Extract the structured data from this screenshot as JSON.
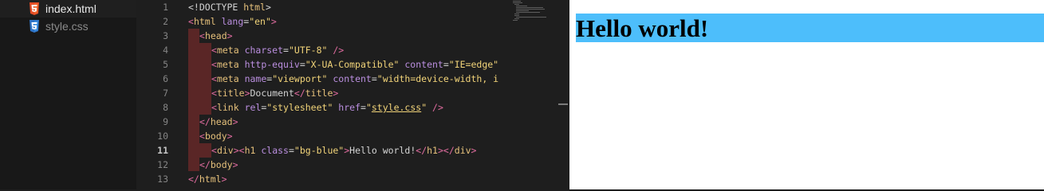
{
  "sidebar": {
    "files": [
      {
        "name": "index.html",
        "icon": "html5-file-icon",
        "icon_color": "#e44d26",
        "active": true
      },
      {
        "name": "style.css",
        "icon": "css3-file-icon",
        "icon_color": "#3d8fe0",
        "active": false
      }
    ]
  },
  "editor": {
    "current_line": "11",
    "line_numbers": [
      "1",
      "2",
      "3",
      "4",
      "5",
      "6",
      "7",
      "8",
      "9",
      "10",
      "11",
      "12",
      "13"
    ],
    "lines": {
      "l1": {
        "p1": "<!DOCTYPE ",
        "p2": "html",
        "p3": ">"
      },
      "l2": {
        "p1": "<",
        "p2": "html",
        "p3": " lang",
        "p4": "=",
        "p5": "\"en\"",
        "p6": ">"
      },
      "l3": {
        "p1": "<",
        "p2": "head",
        "p3": ">"
      },
      "l4": {
        "p1": "<",
        "p2": "meta",
        "p3": " charset",
        "p4": "=",
        "p5": "\"UTF-8\"",
        "p6": " />"
      },
      "l5": {
        "p1": "<",
        "p2": "meta",
        "p3": " http-equiv",
        "p4": "=",
        "p5": "\"X-UA-Compatible\"",
        "p6": " content",
        "p7": "=",
        "p8": "\"IE=edge\""
      },
      "l6": {
        "p1": "<",
        "p2": "meta",
        "p3": " name",
        "p4": "=",
        "p5": "\"viewport\"",
        "p6": " content",
        "p7": "=",
        "p8": "\"width=device-width, i"
      },
      "l7": {
        "p1": "<",
        "p2": "title",
        "p3": ">",
        "p4": "Document",
        "p5": "</",
        "p6": "title",
        "p7": ">"
      },
      "l8": {
        "p1": "<",
        "p2": "link",
        "p3": " rel",
        "p4": "=",
        "p5": "\"stylesheet\"",
        "p6": " href",
        "p7": "=",
        "p8": "\"",
        "p9": "style.css",
        "p10": "\"",
        "p11": " />"
      },
      "l9": {
        "p1": "</",
        "p2": "head",
        "p3": ">"
      },
      "l10": {
        "p1": "<",
        "p2": "body",
        "p3": ">"
      },
      "l11": {
        "p1": "<",
        "p2": "div",
        "p3": "><",
        "p4": "h1",
        "p5": " class",
        "p6": "=",
        "p7": "\"bg-blue\"",
        "p8": ">",
        "p9": "Hello world!",
        "p10": "</",
        "p11": "h1",
        "p12": "></",
        "p13": "div",
        "p14": ">"
      },
      "l12": {
        "p1": "</",
        "p2": "body",
        "p3": ">"
      },
      "l13": {
        "p1": "</",
        "p2": "html",
        "p3": ">"
      }
    }
  },
  "preview": {
    "heading": "Hello world!",
    "heading_bg": "#4dbefb"
  },
  "colors": {
    "tag": "#e06c9f",
    "tag_name": "#e5c07b",
    "attribute": "#bb8fe0",
    "string": "#f2d479",
    "guide_highlight": "#5a2626"
  }
}
